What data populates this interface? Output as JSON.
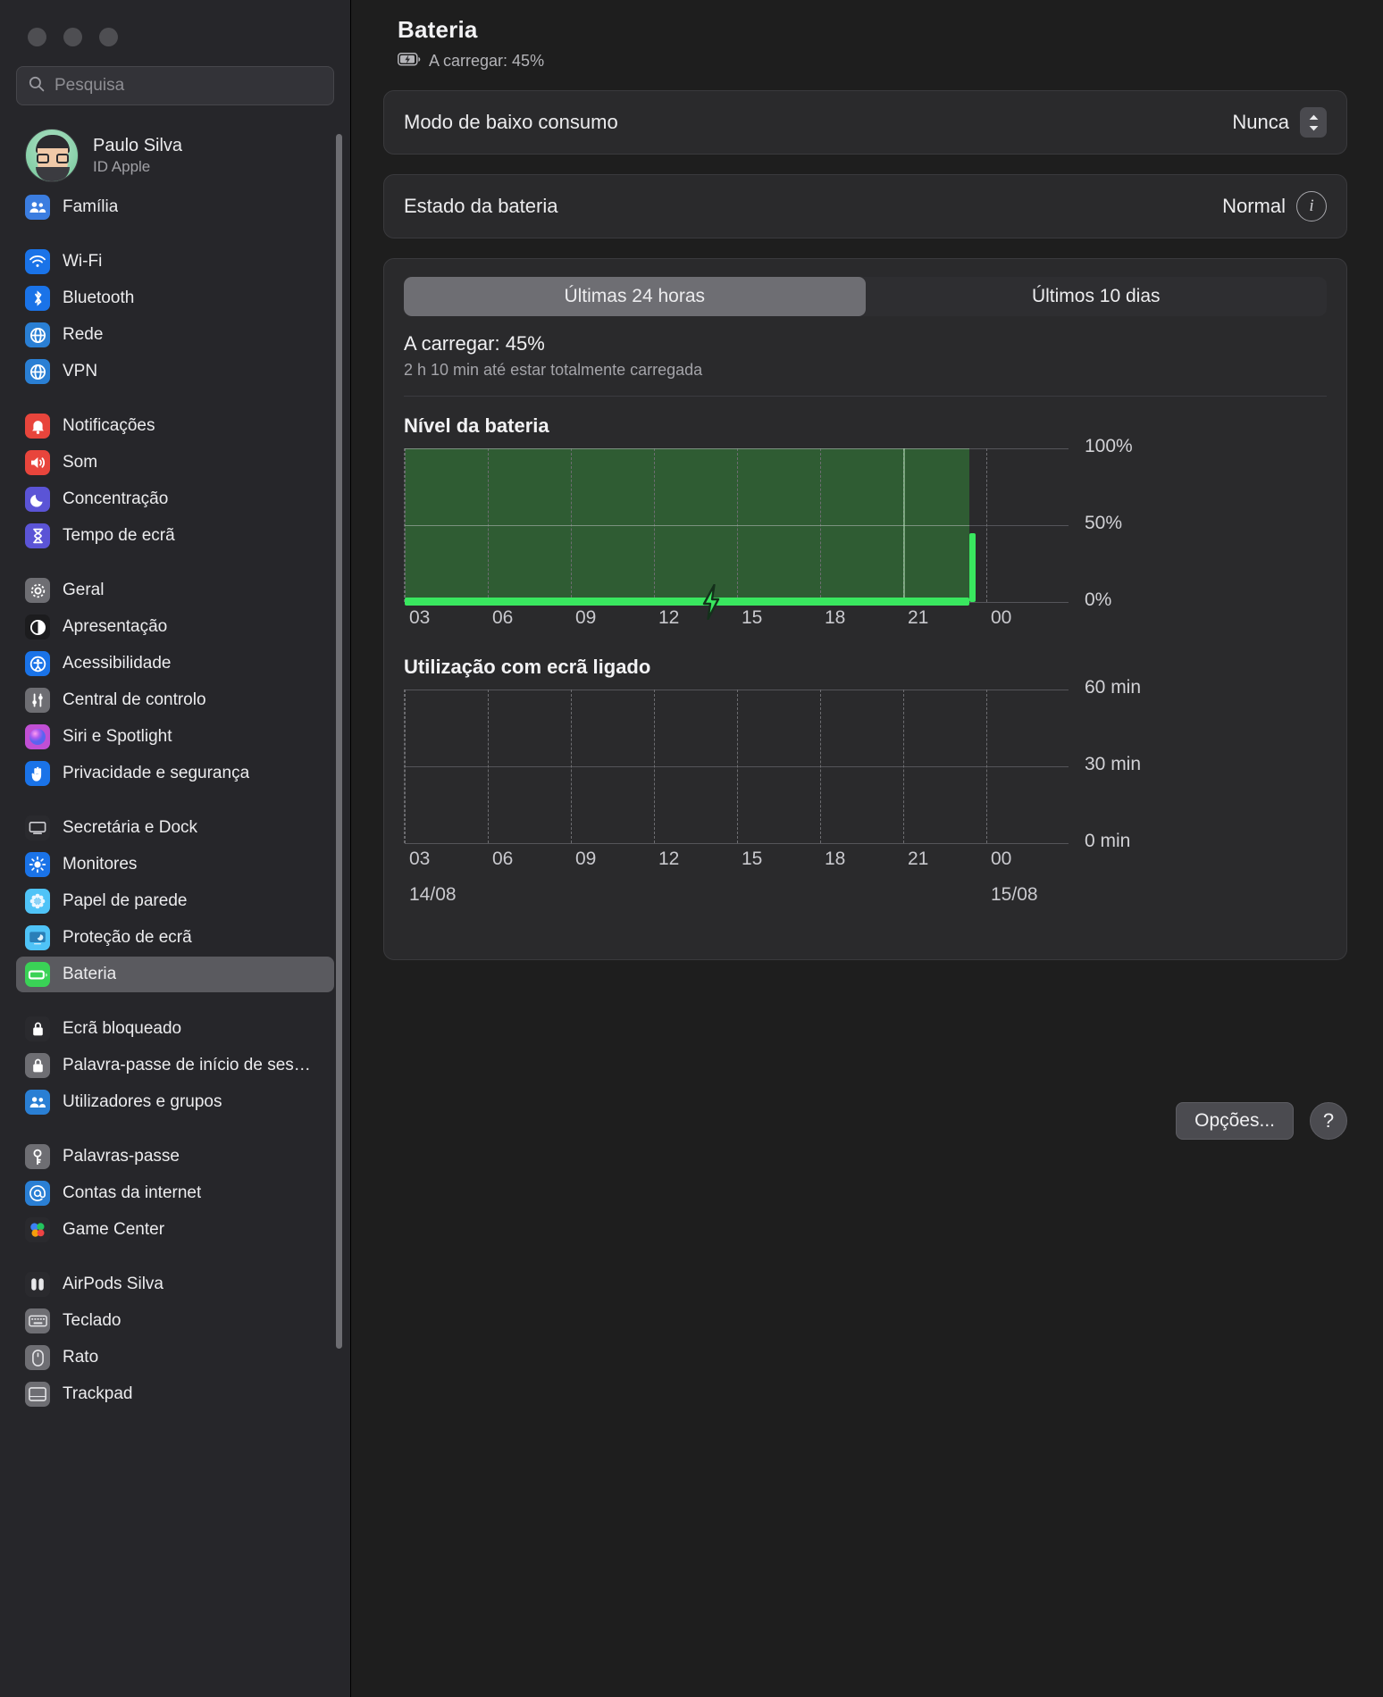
{
  "window": {
    "traffic_lights": [
      "close",
      "minimize",
      "zoom"
    ]
  },
  "sidebar": {
    "search": {
      "placeholder": "Pesquisa",
      "value": ""
    },
    "account": {
      "name": "Paulo Silva",
      "subtitle": "ID Apple"
    },
    "groups": [
      {
        "items": [
          {
            "label": "Família",
            "icon": "family-icon",
            "color": "#3b7de0",
            "glyph": "👥"
          }
        ]
      },
      {
        "items": [
          {
            "label": "Wi-Fi",
            "icon": "wifi-icon",
            "color": "#1a73e8",
            "glyph": "wifi"
          },
          {
            "label": "Bluetooth",
            "icon": "bluetooth-icon",
            "color": "#1a73e8",
            "glyph": "bt"
          },
          {
            "label": "Rede",
            "icon": "network-icon",
            "color": "#2a7fd4",
            "glyph": "globe"
          },
          {
            "label": "VPN",
            "icon": "vpn-icon",
            "color": "#2a7fd4",
            "glyph": "globe"
          }
        ]
      },
      {
        "items": [
          {
            "label": "Notificações",
            "icon": "notifications-icon",
            "color": "#e8453c",
            "glyph": "bell"
          },
          {
            "label": "Som",
            "icon": "sound-icon",
            "color": "#e8453c",
            "glyph": "speaker"
          },
          {
            "label": "Concentração",
            "icon": "focus-icon",
            "color": "#5b54d6",
            "glyph": "moon"
          },
          {
            "label": "Tempo de ecrã",
            "icon": "screen-time-icon",
            "color": "#5b54d6",
            "glyph": "hourglass"
          }
        ]
      },
      {
        "items": [
          {
            "label": "Geral",
            "icon": "general-icon",
            "color": "#6e6e73",
            "glyph": "gear"
          },
          {
            "label": "Apresentação",
            "icon": "appearance-icon",
            "color": "#1c1c1e",
            "glyph": "halfcircle"
          },
          {
            "label": "Acessibilidade",
            "icon": "accessibility-icon",
            "color": "#1a73e8",
            "glyph": "person"
          },
          {
            "label": "Central de controlo",
            "icon": "control-center-icon",
            "color": "#6e6e73",
            "glyph": "switches"
          },
          {
            "label": "Siri e Spotlight",
            "icon": "siri-icon",
            "color": "#c04fd4",
            "glyph": "orb"
          },
          {
            "label": "Privacidade e segurança",
            "icon": "privacy-icon",
            "color": "#1a73e8",
            "glyph": "hand"
          }
        ]
      },
      {
        "items": [
          {
            "label": "Secretária e Dock",
            "icon": "desktop-dock-icon",
            "color": "#2a2a2e",
            "glyph": "dock"
          },
          {
            "label": "Monitores",
            "icon": "displays-icon",
            "color": "#1a73e8",
            "glyph": "brightness"
          },
          {
            "label": "Papel de parede",
            "icon": "wallpaper-icon",
            "color": "#4fc3f7",
            "glyph": "flower"
          },
          {
            "label": "Proteção de ecrã",
            "icon": "screensaver-icon",
            "color": "#4fc3f7",
            "glyph": "screen"
          },
          {
            "label": "Bateria",
            "icon": "battery-icon",
            "color": "#3ad256",
            "glyph": "battery",
            "selected": true
          }
        ]
      },
      {
        "items": [
          {
            "label": "Ecrã bloqueado",
            "icon": "lock-screen-icon",
            "color": "#2a2a2e",
            "glyph": "lock"
          },
          {
            "label": "Palavra-passe de início de ses…",
            "icon": "login-password-icon",
            "color": "#6e6e73",
            "glyph": "lock"
          },
          {
            "label": "Utilizadores e grupos",
            "icon": "users-groups-icon",
            "color": "#2a7fd4",
            "glyph": "people"
          }
        ]
      },
      {
        "items": [
          {
            "label": "Palavras-passe",
            "icon": "passwords-icon",
            "color": "#6e6e73",
            "glyph": "key"
          },
          {
            "label": "Contas da internet",
            "icon": "internet-accounts-icon",
            "color": "#2a7fd4",
            "glyph": "at"
          },
          {
            "label": "Game Center",
            "icon": "game-center-icon",
            "color": "#2a2a2e",
            "glyph": "balloons"
          }
        ]
      },
      {
        "items": [
          {
            "label": "AirPods Silva",
            "icon": "airpods-icon",
            "color": "#2a2a2e",
            "glyph": "airpods"
          },
          {
            "label": "Teclado",
            "icon": "keyboard-icon",
            "color": "#6e6e73",
            "glyph": "keyboard"
          },
          {
            "label": "Rato",
            "icon": "mouse-icon",
            "color": "#6e6e73",
            "glyph": "mouse"
          },
          {
            "label": "Trackpad",
            "icon": "trackpad-icon",
            "color": "#6e6e73",
            "glyph": "trackpad"
          }
        ]
      }
    ]
  },
  "main": {
    "title": "Bateria",
    "subtitle": "A carregar: 45%",
    "low_power": {
      "label": "Modo de baixo consumo",
      "value": "Nunca"
    },
    "battery_health": {
      "label": "Estado da bateria",
      "value": "Normal",
      "info_label": "i"
    },
    "tabs": [
      {
        "label": "Últimas 24 horas",
        "selected": true
      },
      {
        "label": "Últimos 10 dias",
        "selected": false
      }
    ],
    "status": {
      "headline": "A carregar: 45%",
      "detail": "2 h 10 min até estar totalmente carregada"
    },
    "options_button": "Opções...",
    "help_button": "?"
  },
  "chart_data": [
    {
      "type": "area",
      "title": "Nível da bateria",
      "xlabel": "",
      "ylabel": "",
      "ylim": [
        0,
        100
      ],
      "ytick_labels": [
        "100%",
        "50%",
        "0%"
      ],
      "ytick_values": [
        100,
        50,
        0
      ],
      "xtick_labels": [
        "03",
        "06",
        "09",
        "12",
        "15",
        "18",
        "21",
        "00"
      ],
      "grid": true,
      "series": [
        {
          "name": "Nível da bateria",
          "color": "#2f5c33",
          "x": [
            "03",
            "06",
            "09",
            "12",
            "15",
            "18",
            "21",
            "00"
          ],
          "values": [
            100,
            100,
            100,
            100,
            100,
            100,
            100,
            45
          ]
        },
        {
          "name": "A carregar",
          "color": "#39e75f",
          "annotation": "bolt-icon",
          "annotation_x": "13:00",
          "x_start": "02:30",
          "x_end": "00:00",
          "level": 8
        }
      ]
    },
    {
      "type": "bar",
      "title": "Utilização com ecrã ligado",
      "xlabel": "",
      "ylabel": "",
      "ylim": [
        0,
        60
      ],
      "ytick_labels": [
        "60 min",
        "30 min",
        "0 min"
      ],
      "ytick_values": [
        60,
        30,
        0
      ],
      "xtick_labels": [
        "03",
        "06",
        "09",
        "12",
        "15",
        "18",
        "21",
        "00"
      ],
      "xdate_labels": [
        "14/08",
        "15/08"
      ],
      "grid": true,
      "categories": [
        "03",
        "06",
        "09",
        "12",
        "15",
        "18",
        "21",
        "00"
      ],
      "values": [
        0,
        0,
        0,
        0,
        0,
        0,
        0,
        0
      ]
    }
  ]
}
